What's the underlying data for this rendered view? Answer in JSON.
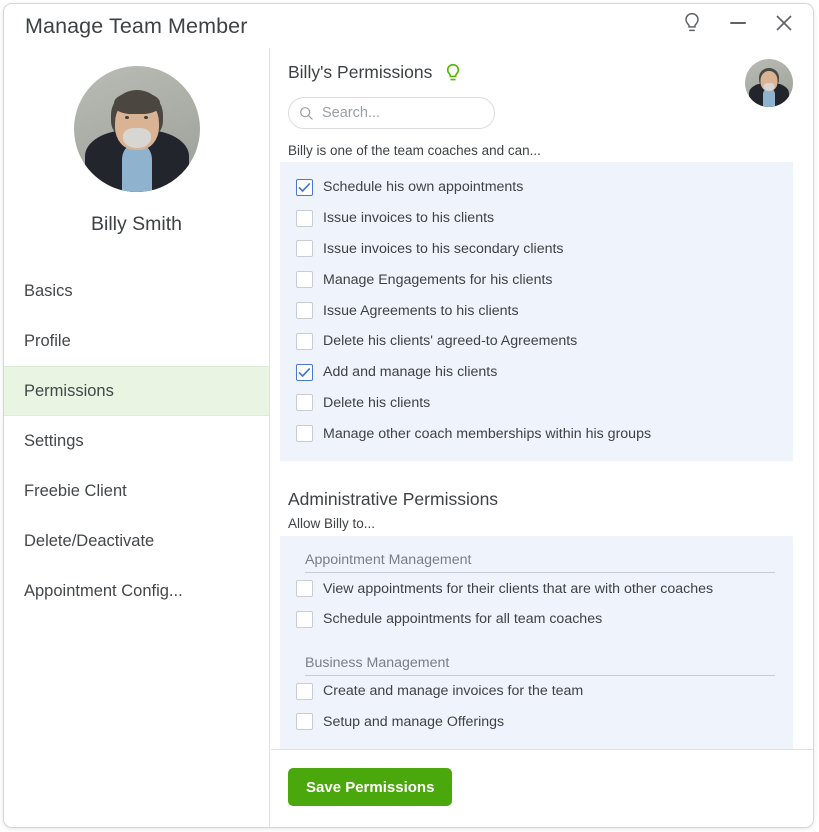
{
  "window": {
    "title": "Manage Team Member",
    "controls": [
      {
        "name": "hint-bulb-icon",
        "label": ""
      },
      {
        "name": "minimize-button",
        "label": ""
      },
      {
        "name": "close-button",
        "label": "✕"
      }
    ]
  },
  "sidebar": {
    "member_name": "Billy Smith",
    "avatar_alt": "Billy Smith portrait",
    "items": [
      {
        "label": "Basics",
        "active": false
      },
      {
        "label": "Profile",
        "active": false
      },
      {
        "label": "Permissions",
        "active": true
      },
      {
        "label": "Settings",
        "active": false
      },
      {
        "label": "Freebie Client",
        "active": false
      },
      {
        "label": "Delete/Deactivate",
        "active": false
      },
      {
        "label": "Appointment Config...",
        "active": false
      }
    ]
  },
  "main": {
    "title": "Billy's Permissions",
    "hint_icon": "lightbulb-icon",
    "header_avatar_alt": "Billy Smith avatar",
    "search": {
      "placeholder": "Search...",
      "value": "",
      "icon": "search-icon"
    },
    "coach_intro": "Billy is one of the team coaches and can...",
    "coach_permissions": [
      {
        "label": "Schedule his own appointments",
        "checked": true
      },
      {
        "label": "Issue invoices to his clients",
        "checked": false
      },
      {
        "label": "Issue invoices to his secondary clients",
        "checked": false
      },
      {
        "label": "Manage Engagements for his clients",
        "checked": false
      },
      {
        "label": "Issue Agreements to his clients",
        "checked": false
      },
      {
        "label": "Delete his clients' agreed-to Agreements",
        "checked": false
      },
      {
        "label": "Add and manage his clients",
        "checked": true
      },
      {
        "label": "Delete his clients",
        "checked": false
      },
      {
        "label": "Manage other coach memberships within his groups",
        "checked": false
      }
    ],
    "admin_title": "Administrative Permissions",
    "admin_sub": "Allow Billy to...",
    "admin_groups": [
      {
        "title": "Appointment Management",
        "items": [
          {
            "label": "View appointments for their clients that are with other coaches",
            "checked": false
          },
          {
            "label": "Schedule appointments for all team coaches",
            "checked": false
          }
        ]
      },
      {
        "title": "Business Management",
        "items": [
          {
            "label": "Create and manage invoices for the team",
            "checked": false
          },
          {
            "label": "Setup and manage Offerings",
            "checked": false
          }
        ]
      }
    ]
  },
  "footer": {
    "save_label": "Save Permissions"
  },
  "colors": {
    "accent_green": "#4ba80c",
    "bulb_green": "#55b500",
    "panel_blue": "#eff3fb",
    "active_nav": "#eaf4e3",
    "checkbox_blue": "#4a76d4"
  }
}
